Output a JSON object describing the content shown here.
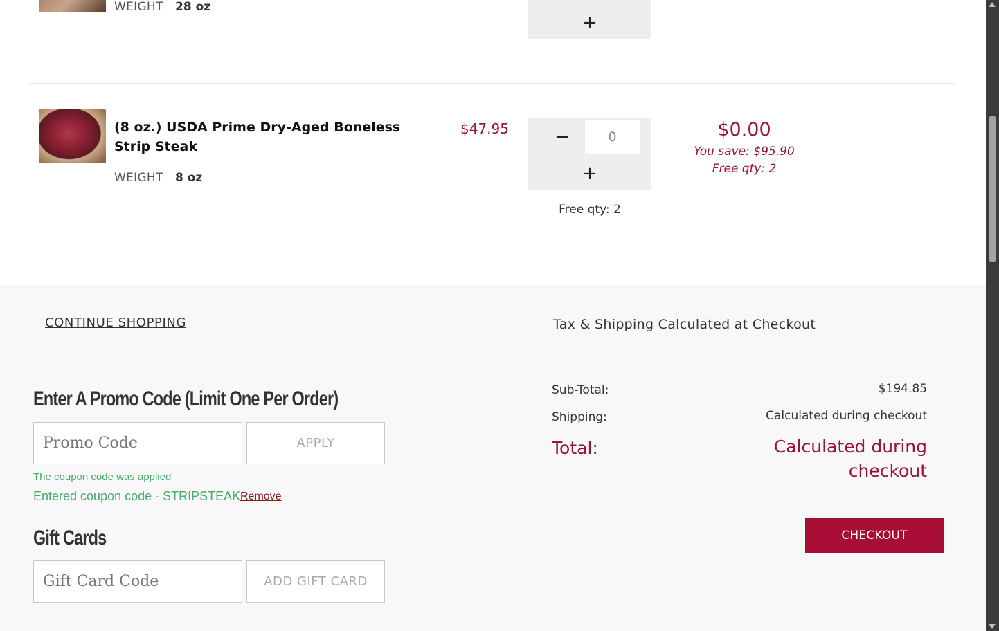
{
  "item_above": {
    "weight_label": "WEIGHT",
    "weight_value": "28 oz",
    "qty_plus": "+"
  },
  "item": {
    "name": "(8 oz.) USDA Prime Dry-Aged Boneless Strip Steak",
    "price": "$47.95",
    "weight_label": "WEIGHT",
    "weight_value": "8 oz",
    "qty_minus": "−",
    "qty_plus": "+",
    "qty_value": "0",
    "free_qty_note": "Free qty: 2",
    "line_total": "$0.00",
    "you_save": "You save: $95.90",
    "free_qty_italic": "Free qty: 2"
  },
  "footer": {
    "continue_shopping": "CONTINUE SHOPPING",
    "tax_note": "Tax & Shipping Calculated at Checkout"
  },
  "promo": {
    "heading": "Enter A Promo Code (Limit One Per Order)",
    "placeholder": "Promo Code",
    "apply_label": "APPLY",
    "applied_message": "The coupon code was applied",
    "entered_code": "Entered coupon code - STRIPSTEAK",
    "remove_label": "Remove"
  },
  "gift_cards": {
    "heading": "Gift Cards",
    "placeholder": "Gift Card Code",
    "add_label": "ADD GIFT CARD"
  },
  "summary": {
    "subtotal_label": "Sub-Total:",
    "subtotal_value": "$194.85",
    "shipping_label": "Shipping:",
    "shipping_value": "Calculated during checkout",
    "total_label": "Total:",
    "total_value": "Calculated during checkout",
    "checkout_label": "CHECKOUT"
  },
  "colors": {
    "accent": "#9b1438",
    "checkout_button": "#a80d35",
    "success_green": "#4aa86a"
  }
}
